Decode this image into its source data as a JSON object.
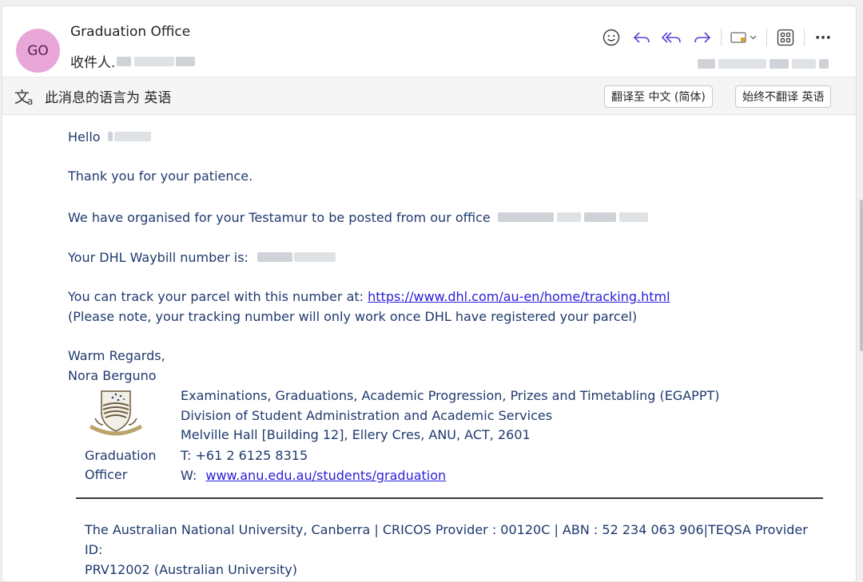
{
  "header": {
    "avatar_initials": "GO",
    "sender_name": "Graduation Office",
    "to_label": "收件人."
  },
  "toolbar": {
    "emoji": "smile-icon",
    "reply": "reply-icon",
    "reply_all": "reply-all-icon",
    "forward": "forward-icon",
    "tag": "tag-icon",
    "apps": "apps-icon",
    "more": "···"
  },
  "translation": {
    "message": "此消息的语言为 英语",
    "translate_button": "翻译至 中文 (简体)",
    "never_translate_button": "始终不翻译 英语"
  },
  "email": {
    "greeting": "Hello",
    "line_patience": "Thank you for your patience.",
    "line_organised": "We have organised for your Testamur to be posted from our office",
    "line_waybill": "Your DHL Waybill number is:",
    "line_track_prefix": "You can track your parcel with this number at:",
    "track_url": "https://www.dhl.com/au-en/home/tracking.html",
    "line_note": "(Please note, your tracking number will only work once DHL have registered your parcel)",
    "closing": "Warm Regards,",
    "signer": "Nora Berguno"
  },
  "signature": {
    "role_line1": "Graduation",
    "role_line2": "Officer",
    "dept": "Examinations, Graduations, Academic Progression, Prizes and Timetabling (EGAPPT)",
    "division": "Division of Student Administration and Academic Services",
    "address": "Melville Hall [Building 12], Ellery Cres, ANU, ACT, 2601",
    "phone": "T:  +61 2 6125 8315",
    "web_prefix": "W:",
    "web_url": "www.anu.edu.au/students/graduation"
  },
  "footer": {
    "line1": "The Australian National University, Canberra | CRICOS Provider : 00120C | ABN : 52 234 063 906|TEQSA Provider ID:",
    "line2": "PRV12002 (Australian University)"
  },
  "colors": {
    "avatar_bg": "#e9a7d9",
    "body_text": "#1f3a6e",
    "link": "#2a1ed8",
    "icon_accent": "#5b3fd6"
  }
}
